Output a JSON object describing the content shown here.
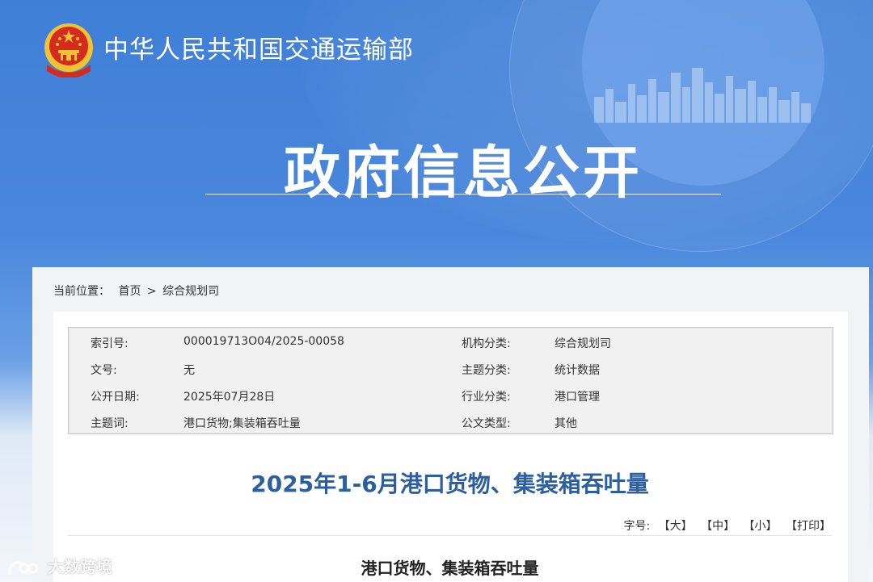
{
  "header": {
    "ministry_name": "中华人民共和国交通运输部",
    "section_title": "政府信息公开"
  },
  "breadcrumb": {
    "prefix": "当前位置：",
    "home": "首页",
    "separator": ">",
    "current": "综合规划司"
  },
  "meta": {
    "rows": [
      {
        "k1": "索引号:",
        "v1": "000019713O04/2025-00058",
        "k2": "机构分类:",
        "v2": "综合规划司"
      },
      {
        "k1": "文号:",
        "v1": "无",
        "k2": "主题分类:",
        "v2": "统计数据"
      },
      {
        "k1": "公开日期:",
        "v1": "2025年07月28日",
        "k2": "行业分类:",
        "v2": "港口管理"
      },
      {
        "k1": "主题词:",
        "v1": "港口货物;集装箱吞吐量",
        "k2": "公文类型:",
        "v2": "其他"
      }
    ]
  },
  "document": {
    "title": "2025年1-6月港口货物、集装箱吞吐量",
    "font_size_label": "字号:",
    "font_large": "【大】",
    "font_medium": "【中】",
    "font_small": "【小】",
    "print": "【打印】",
    "subtitle": "港口货物、集装箱吞吐量"
  },
  "watermark": {
    "text": "大数跨境"
  },
  "colors": {
    "banner_blue": "#3f7fd6",
    "title_blue": "#2d5f9e",
    "emblem_red": "#d42a1f",
    "emblem_gold": "#f1c232"
  }
}
